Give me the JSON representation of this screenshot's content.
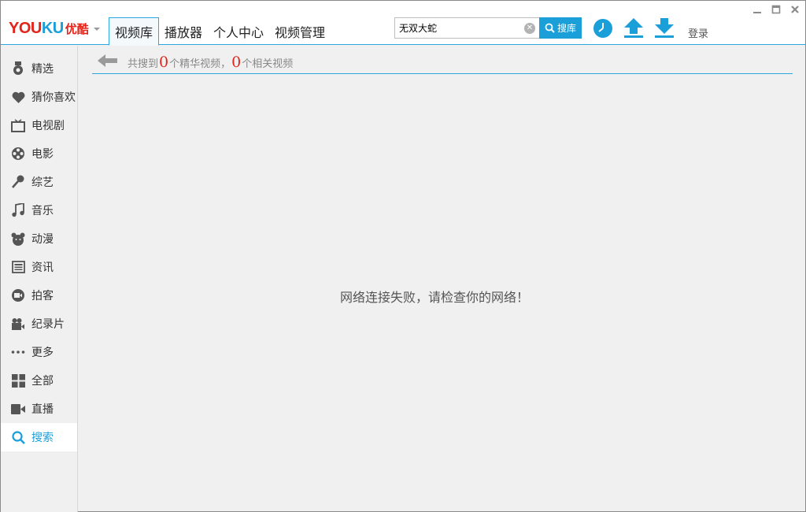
{
  "app": {
    "logo_text_1": "YOU",
    "logo_text_2": "KU",
    "logo_cn": "优酷",
    "brand_red": "#e3241b",
    "brand_blue": "#1a9fd9"
  },
  "header": {
    "tabs": [
      {
        "label": "视频库",
        "active": true
      },
      {
        "label": "播放器",
        "active": false
      },
      {
        "label": "个人中心",
        "active": false
      },
      {
        "label": "视频管理",
        "active": false
      }
    ],
    "search": {
      "value": "无双大蛇",
      "button_label": "搜库"
    },
    "tools": [
      {
        "icon": "history-clock-icon"
      },
      {
        "icon": "upload-arrow-icon"
      },
      {
        "icon": "download-arrow-icon"
      }
    ],
    "login_label": "登录"
  },
  "window_controls": [
    "minimize-icon",
    "maximize-icon",
    "close-icon"
  ],
  "sidebar": {
    "items": [
      {
        "label": "精选",
        "icon": "medal-icon"
      },
      {
        "label": "猜你喜欢",
        "icon": "heart-icon"
      },
      {
        "label": "电视剧",
        "icon": "tv-icon"
      },
      {
        "label": "电影",
        "icon": "film-reel-icon"
      },
      {
        "label": "综艺",
        "icon": "microphone-icon"
      },
      {
        "label": "音乐",
        "icon": "music-note-icon"
      },
      {
        "label": "动漫",
        "icon": "bear-face-icon"
      },
      {
        "label": "资讯",
        "icon": "newspaper-icon"
      },
      {
        "label": "拍客",
        "icon": "camera-icon"
      },
      {
        "label": "纪录片",
        "icon": "movie-camera-icon"
      },
      {
        "label": "更多",
        "icon": "more-dots-icon"
      },
      {
        "label": "全部",
        "icon": "grid-icon"
      },
      {
        "label": "直播",
        "icon": "video-camera-icon"
      },
      {
        "label": "搜索",
        "icon": "search-icon",
        "active": true
      }
    ]
  },
  "results": {
    "prefix": "共搜到",
    "featured_count": "0",
    "featured_suffix": "个精华视频，",
    "related_count": "0",
    "related_suffix": "个相关视频"
  },
  "error_message": "网络连接失败，请检查你的网络！"
}
